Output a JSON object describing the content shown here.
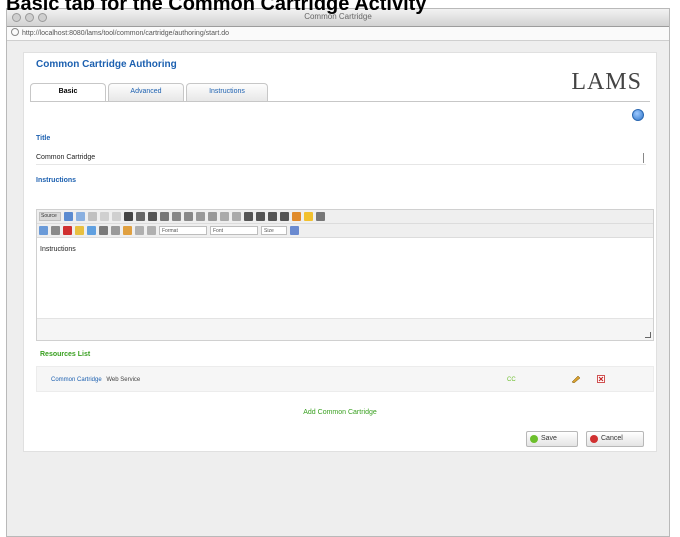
{
  "page_heading": "Basic tab for the Common Cartridge Activity",
  "window": {
    "title": "Common Cartridge",
    "url": "http://localhost:8080/lams/tool/common/cartridge/authoring/start.do"
  },
  "app": {
    "title": "Common Cartridge Authoring",
    "logo": "LAMS"
  },
  "tabs": [
    {
      "label": "Basic"
    },
    {
      "label": "Advanced"
    },
    {
      "label": "Instructions"
    }
  ],
  "form": {
    "title_label": "Title",
    "title_value": "Common Cartridge",
    "instructions_label": "Instructions",
    "editor_content": "Instructions",
    "toolbar": {
      "source_label": "Source",
      "format_select": "Format",
      "font_select": "Font",
      "size_select": "Size"
    }
  },
  "resources": {
    "label": "Resources List",
    "items": [
      {
        "name": "Common Cartridge",
        "type": "Web Service",
        "badge": "CC"
      }
    ],
    "add_link": "Add Common Cartridge"
  },
  "buttons": {
    "save": "Save",
    "cancel": "Cancel"
  },
  "colors": {
    "brand_blue": "#1c60b0",
    "resource_green": "#39a020",
    "delete_red": "#c62828"
  }
}
